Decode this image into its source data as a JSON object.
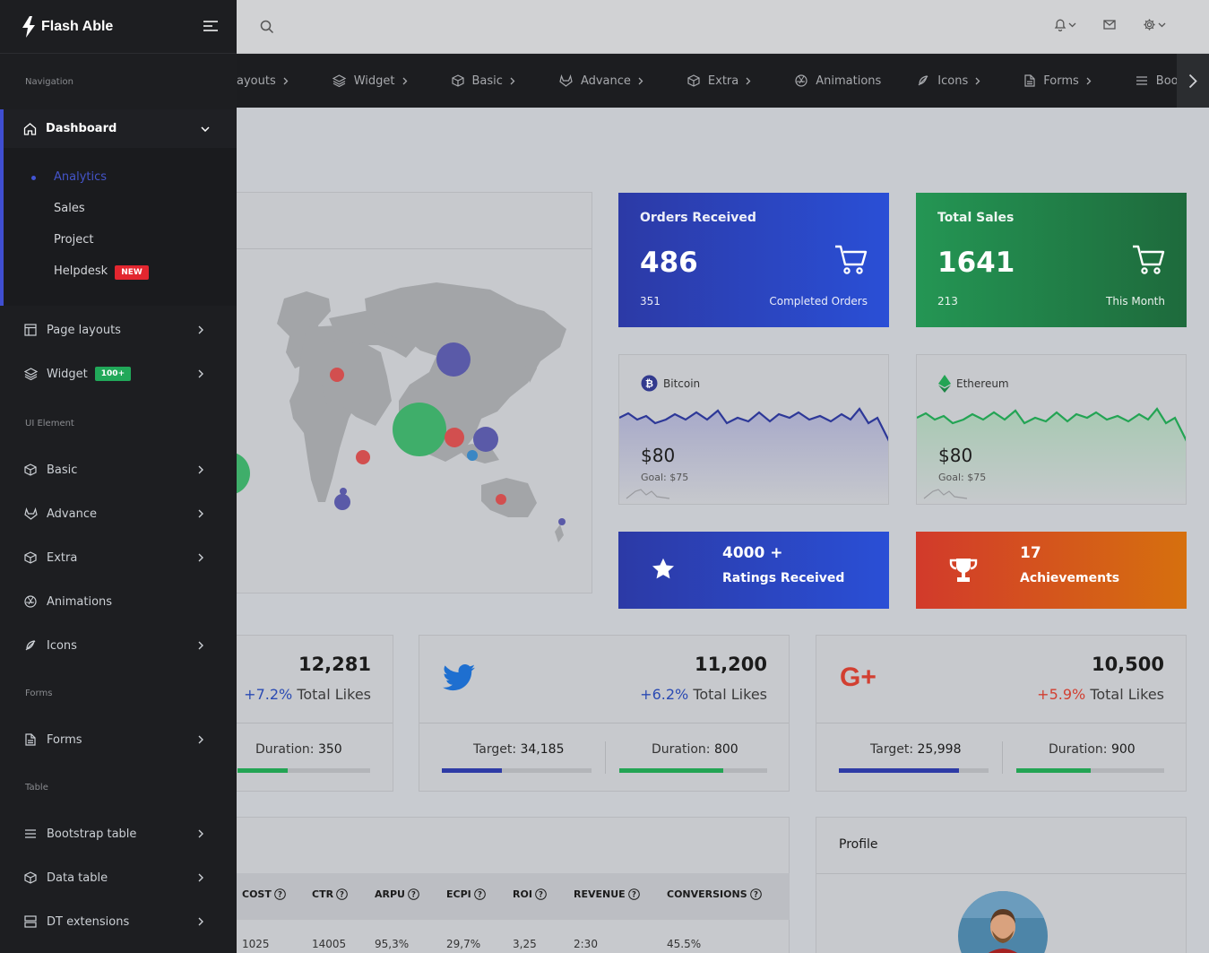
{
  "app": {
    "name": "Flash Able"
  },
  "sidebar": {
    "caption_navigation": "Navigation",
    "dashboard": {
      "label": "Dashboard",
      "subitems": [
        "Analytics",
        "Sales",
        "Project",
        "Helpdesk"
      ],
      "helpdesk_badge": "NEW"
    },
    "page_layouts": "Page layouts",
    "widget": "Widget",
    "widget_badge": "100+",
    "caption_ui": "UI Element",
    "basic": "Basic",
    "advance": "Advance",
    "extra": "Extra",
    "animations": "Animations",
    "icons": "Icons",
    "caption_forms": "Forms",
    "forms": "Forms",
    "caption_table": "Table",
    "bootstrap_table": "Bootstrap table",
    "data_table": "Data table",
    "dt_extensions": "DT extensions"
  },
  "hnav": {
    "items": [
      "ayouts",
      "Widget",
      "Basic",
      "Advance",
      "Extra",
      "Animations",
      "Icons",
      "Forms",
      "Bootstrap tat"
    ]
  },
  "orders": {
    "title": "Orders Received",
    "value": "486",
    "sub_left": "351",
    "sub_right": "Completed Orders"
  },
  "sales": {
    "title": "Total Sales",
    "value": "1641",
    "sub_left": "213",
    "sub_right": "This Month"
  },
  "bitcoin": {
    "name": "Bitcoin",
    "price": "$80",
    "goal": "Goal: $75"
  },
  "ethereum": {
    "name": "Ethereum",
    "price": "$80",
    "goal": "Goal: $75"
  },
  "ratings": {
    "value": "4000 +",
    "label": "Ratings Received"
  },
  "achievements": {
    "value": "17",
    "label": "Achievements"
  },
  "social": {
    "facebook": {
      "value": "12,281",
      "pct": "+7.2%",
      "pct_label": "Total Likes",
      "duration_label": "Duration:",
      "duration": "350",
      "duration_progress": 0.38
    },
    "twitter": {
      "value": "11,200",
      "pct": "+6.2%",
      "pct_label": "Total Likes",
      "target_label": "Target:",
      "target": "34,185",
      "target_progress": 0.4,
      "duration_label": "Duration:",
      "duration": "800",
      "duration_progress": 0.7
    },
    "google": {
      "value": "10,500",
      "pct": "+5.9%",
      "pct_label": "Total Likes",
      "target_label": "Target:",
      "target": "25,998",
      "target_progress": 0.8,
      "duration_label": "Duration:",
      "duration": "900",
      "duration_progress": 0.5
    }
  },
  "table": {
    "columns": [
      "COST",
      "CTR",
      "ARPU",
      "ECPI",
      "ROI",
      "REVENUE",
      "CONVERSIONS"
    ],
    "row1": [
      "1025",
      "14005",
      "95,3%",
      "29,7%",
      "3,25",
      "2:30",
      "45.5%"
    ]
  },
  "profile": {
    "title": "Profile"
  },
  "colors": {
    "accent": "#3f4ed1",
    "green": "#24a255",
    "red": "#d5372e",
    "orange": "#d96f0a"
  }
}
